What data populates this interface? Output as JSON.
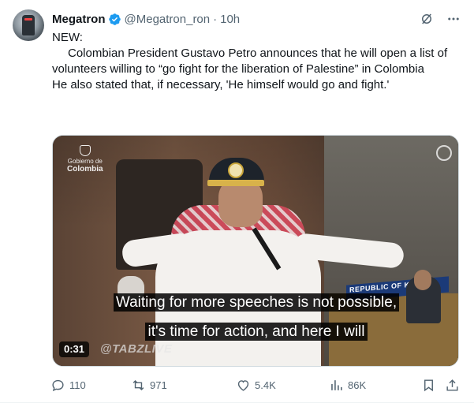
{
  "post": {
    "author_name": "Megatron",
    "handle": "@Megatron_ron",
    "separator": "·",
    "time": "10h",
    "verified": true,
    "accent_color": "#1d9bf0",
    "text": {
      "p1": "NEW:",
      "p2": "Colombian President Gustavo Petro announces that he will open a list of volunteers willing to “go fight for the liberation of Palestine” in Colombia",
      "p3": "He also stated that, if necessary, 'He himself would go and fight.'"
    },
    "media": {
      "type": "video",
      "duration": "0:31",
      "subtitle_line1": "Waiting for more speeches is not possible,",
      "subtitle_line2": "it's time for action, and here I will",
      "watermark": "@TABZLIVE",
      "broadcaster_logo_line1": "Gobierno de",
      "broadcaster_logo_line2": "Colombia",
      "nameplate": "REPUBLIC OF KOREA"
    },
    "stats": {
      "replies": "110",
      "reposts": "971",
      "likes": "5.4K",
      "views": "86K"
    }
  },
  "icons": {
    "verified": "verified-badge-icon",
    "grok": "grok-icon",
    "more": "more-icon",
    "reply": "reply-icon",
    "repost": "repost-icon",
    "like": "heart-icon",
    "views": "views-chart-icon",
    "bookmark": "bookmark-icon",
    "share": "share-icon"
  }
}
